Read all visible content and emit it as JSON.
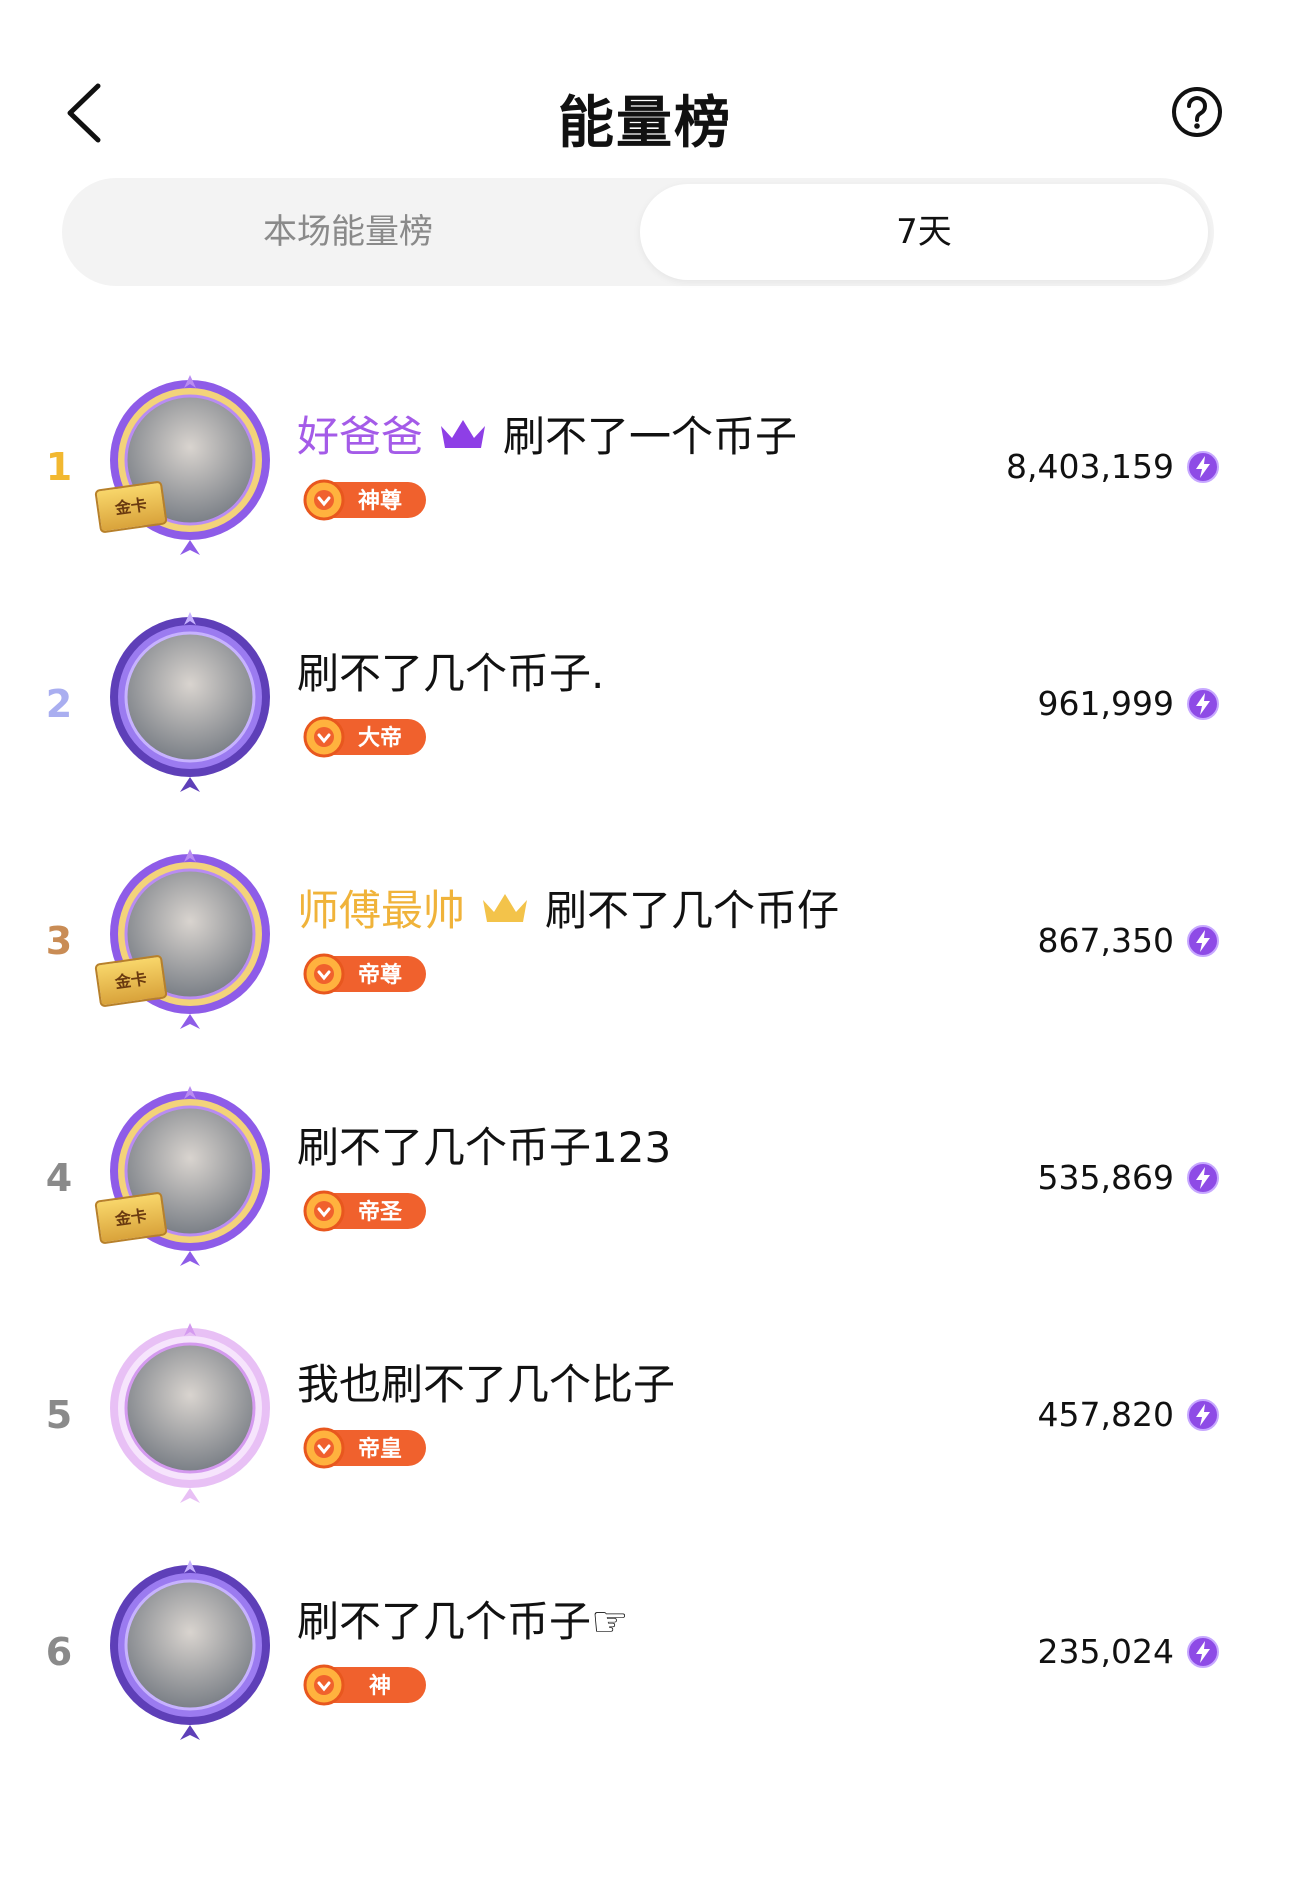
{
  "header": {
    "title": "能量榜"
  },
  "tabs": [
    {
      "label": "本场能量榜",
      "active": false
    },
    {
      "label": "7天",
      "active": true
    }
  ],
  "colors": {
    "rank1": "#F2B830",
    "rank2": "#A9AEF0",
    "rank3": "#C98C55",
    "rank_other": "#8A8A8A",
    "purple_name": "#A45BE8",
    "gold_name": "#F0B33A",
    "badge_orange": "#F0612D",
    "energy_purple": "#8E4BE6"
  },
  "entries": [
    {
      "rank": "1",
      "prefix": "好爸爸",
      "prefix_style": "purple",
      "name": "刷不了一个币子",
      "badge": "神尊",
      "score": "8,403,159",
      "frame": "gold"
    },
    {
      "rank": "2",
      "prefix": "",
      "prefix_style": "",
      "name": "刷不了几个币子.",
      "badge": "大帝",
      "score": "961,999",
      "frame": "purple"
    },
    {
      "rank": "3",
      "prefix": "师傅最帅",
      "prefix_style": "gold",
      "name": "刷不了几个币仔",
      "badge": "帝尊",
      "score": "867,350",
      "frame": "gold"
    },
    {
      "rank": "4",
      "prefix": "",
      "prefix_style": "",
      "name": "刷不了几个币子123",
      "badge": "帝圣",
      "score": "535,869",
      "frame": "gold"
    },
    {
      "rank": "5",
      "prefix": "",
      "prefix_style": "",
      "name": "我也刷不了几个比子",
      "badge": "帝皇",
      "score": "457,820",
      "frame": "lilac"
    },
    {
      "rank": "6",
      "prefix": "",
      "prefix_style": "",
      "name": "刷不了几个币子☞",
      "badge": "神",
      "score": "235,024",
      "frame": "purple"
    }
  ],
  "card_label": "金卡"
}
